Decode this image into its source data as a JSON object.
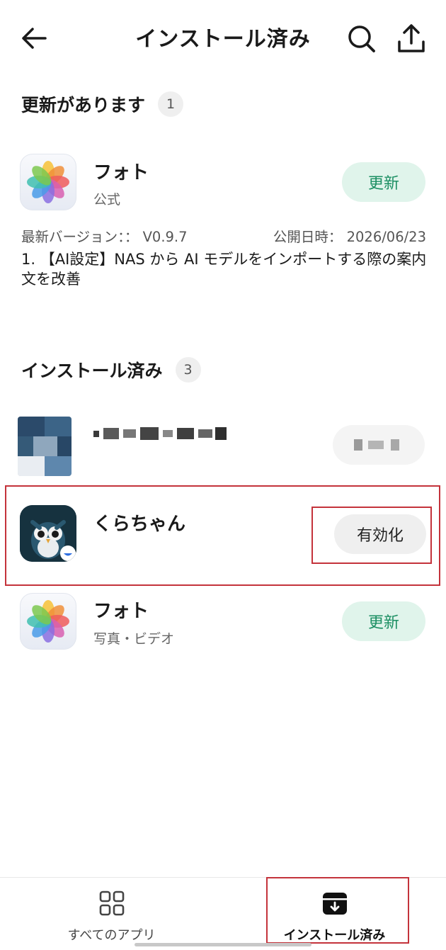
{
  "header": {
    "title": "インストール済み",
    "back_icon": "arrow-left-icon",
    "search_icon": "search-icon",
    "share_icon": "upload-icon"
  },
  "updates_section": {
    "title": "更新があります",
    "count": "1",
    "app": {
      "name": "フォト",
      "subtitle": "公式",
      "action": "更新",
      "version_label": "最新バージョン：：",
      "version": "V0.9.7",
      "date_label": "公開日時：",
      "date": "2026/06/23",
      "notes": "1. 【AI設定】NAS から AI モデルをインポートする際の案内文を改善"
    }
  },
  "installed_section": {
    "title": "インストール済み",
    "count": "3",
    "apps": [
      {
        "name": "",
        "subtitle": "",
        "action": "",
        "obscured": true
      },
      {
        "name": "くらちゃん",
        "subtitle": "",
        "action": "有効化"
      },
      {
        "name": "フォト",
        "subtitle": "写真・ビデオ",
        "action": "更新"
      }
    ]
  },
  "bottom_nav": {
    "items": [
      {
        "label": "すべてのアプリ",
        "icon": "grid-icon",
        "active": false
      },
      {
        "label": "インストール済み",
        "icon": "installed-box-icon",
        "active": true
      }
    ]
  },
  "colors": {
    "accent_green": "#1c8f63",
    "update_pill_bg": "#e0f4eb",
    "highlight_red": "#c4333b"
  }
}
